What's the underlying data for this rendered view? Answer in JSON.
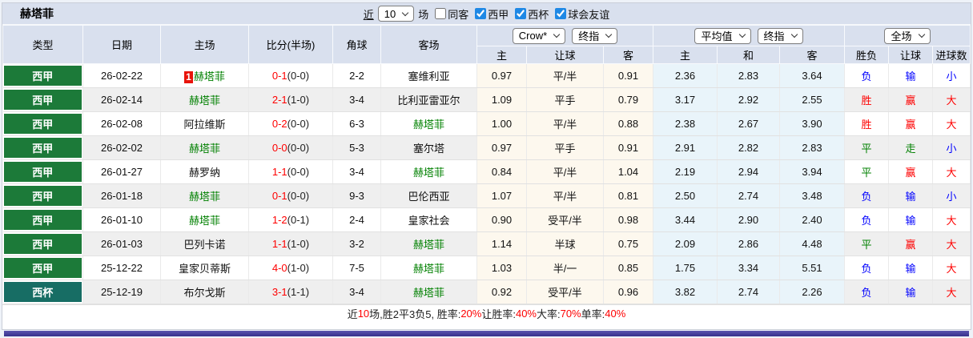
{
  "title": "赫塔菲",
  "toolbar": {
    "recent_label": "近",
    "recent_value": "10",
    "matches_label": "场",
    "checkboxes": [
      {
        "label": "同客",
        "checked": false
      },
      {
        "label": "西甲",
        "checked": true
      },
      {
        "label": "西杯",
        "checked": true
      },
      {
        "label": "球会友谊",
        "checked": true
      }
    ]
  },
  "table": {
    "columns": [
      "类型",
      "日期",
      "主场",
      "比分(半场)",
      "角球",
      "客场"
    ],
    "selects": {
      "bookmaker": "Crow*",
      "bookmaker_stage": "终指",
      "average": "平均值",
      "average_stage": "终指",
      "scope": "全场"
    },
    "sub_columns": [
      "主",
      "让球",
      "客",
      "主",
      "和",
      "客",
      "胜负",
      "让球",
      "进球数"
    ],
    "rows": [
      {
        "type": "西甲",
        "type_style": "league",
        "date": "26-02-22",
        "home": {
          "name": "赫塔菲",
          "green": true,
          "badge": "1"
        },
        "score": "0-1",
        "half": "(0-0)",
        "corners": "2-2",
        "away": {
          "name": "塞维利亚",
          "green": false
        },
        "odds": {
          "home": "0.97",
          "handicap": "平/半",
          "away": "0.91"
        },
        "avg": {
          "home": "2.36",
          "draw": "2.83",
          "away": "3.64"
        },
        "outcome": [
          {
            "text": "负",
            "c": "blue"
          },
          {
            "text": "输",
            "c": "blue"
          },
          {
            "text": "小",
            "c": "blue"
          }
        ]
      },
      {
        "type": "西甲",
        "type_style": "league",
        "date": "26-02-14",
        "home": {
          "name": "赫塔菲",
          "green": true
        },
        "score": "2-1",
        "half": "(1-0)",
        "corners": "3-4",
        "away": {
          "name": "比利亚雷亚尔",
          "green": false
        },
        "odds": {
          "home": "1.09",
          "handicap": "平手",
          "away": "0.79"
        },
        "avg": {
          "home": "3.17",
          "draw": "2.92",
          "away": "2.55"
        },
        "outcome": [
          {
            "text": "胜",
            "c": "red"
          },
          {
            "text": "赢",
            "c": "red"
          },
          {
            "text": "大",
            "c": "red"
          }
        ]
      },
      {
        "type": "西甲",
        "type_style": "league",
        "date": "26-02-08",
        "home": {
          "name": "阿拉维斯",
          "green": false
        },
        "score": "0-2",
        "half": "(0-0)",
        "corners": "6-3",
        "away": {
          "name": "赫塔菲",
          "green": true
        },
        "odds": {
          "home": "1.00",
          "handicap": "平/半",
          "away": "0.88"
        },
        "avg": {
          "home": "2.38",
          "draw": "2.67",
          "away": "3.90"
        },
        "outcome": [
          {
            "text": "胜",
            "c": "red"
          },
          {
            "text": "赢",
            "c": "red"
          },
          {
            "text": "大",
            "c": "red"
          }
        ]
      },
      {
        "type": "西甲",
        "type_style": "league",
        "date": "26-02-02",
        "home": {
          "name": "赫塔菲",
          "green": true
        },
        "score": "0-0",
        "half": "(0-0)",
        "corners": "5-3",
        "away": {
          "name": "塞尔塔",
          "green": false
        },
        "odds": {
          "home": "0.97",
          "handicap": "平手",
          "away": "0.91"
        },
        "avg": {
          "home": "2.91",
          "draw": "2.82",
          "away": "2.83"
        },
        "outcome": [
          {
            "text": "平",
            "c": "green"
          },
          {
            "text": "走",
            "c": "green"
          },
          {
            "text": "小",
            "c": "blue"
          }
        ]
      },
      {
        "type": "西甲",
        "type_style": "league",
        "date": "26-01-27",
        "home": {
          "name": "赫罗纳",
          "green": false
        },
        "score": "1-1",
        "half": "(0-0)",
        "corners": "3-4",
        "away": {
          "name": "赫塔菲",
          "green": true
        },
        "odds": {
          "home": "0.84",
          "handicap": "平/半",
          "away": "1.04"
        },
        "avg": {
          "home": "2.19",
          "draw": "2.94",
          "away": "3.94"
        },
        "outcome": [
          {
            "text": "平",
            "c": "green"
          },
          {
            "text": "赢",
            "c": "red"
          },
          {
            "text": "大",
            "c": "red"
          }
        ]
      },
      {
        "type": "西甲",
        "type_style": "league",
        "date": "26-01-18",
        "home": {
          "name": "赫塔菲",
          "green": true
        },
        "score": "0-1",
        "half": "(0-0)",
        "corners": "9-3",
        "away": {
          "name": "巴伦西亚",
          "green": false
        },
        "odds": {
          "home": "1.07",
          "handicap": "平/半",
          "away": "0.81"
        },
        "avg": {
          "home": "2.50",
          "draw": "2.74",
          "away": "3.48"
        },
        "outcome": [
          {
            "text": "负",
            "c": "blue"
          },
          {
            "text": "输",
            "c": "blue"
          },
          {
            "text": "小",
            "c": "blue"
          }
        ]
      },
      {
        "type": "西甲",
        "type_style": "league",
        "date": "26-01-10",
        "home": {
          "name": "赫塔菲",
          "green": true
        },
        "score": "1-2",
        "half": "(0-1)",
        "corners": "2-4",
        "away": {
          "name": "皇家社会",
          "green": false
        },
        "odds": {
          "home": "0.90",
          "handicap": "受平/半",
          "away": "0.98"
        },
        "avg": {
          "home": "3.44",
          "draw": "2.90",
          "away": "2.40"
        },
        "outcome": [
          {
            "text": "负",
            "c": "blue"
          },
          {
            "text": "输",
            "c": "blue"
          },
          {
            "text": "大",
            "c": "red"
          }
        ]
      },
      {
        "type": "西甲",
        "type_style": "league",
        "date": "26-01-03",
        "home": {
          "name": "巴列卡诺",
          "green": false
        },
        "score": "1-1",
        "half": "(1-0)",
        "corners": "3-2",
        "away": {
          "name": "赫塔菲",
          "green": true
        },
        "odds": {
          "home": "1.14",
          "handicap": "半球",
          "away": "0.75"
        },
        "avg": {
          "home": "2.09",
          "draw": "2.86",
          "away": "4.48"
        },
        "outcome": [
          {
            "text": "平",
            "c": "green"
          },
          {
            "text": "赢",
            "c": "red"
          },
          {
            "text": "大",
            "c": "red"
          }
        ]
      },
      {
        "type": "西甲",
        "type_style": "league",
        "date": "25-12-22",
        "home": {
          "name": "皇家贝蒂斯",
          "green": false
        },
        "score": "4-0",
        "half": "(1-0)",
        "corners": "7-5",
        "away": {
          "name": "赫塔菲",
          "green": true
        },
        "odds": {
          "home": "1.03",
          "handicap": "半/一",
          "away": "0.85"
        },
        "avg": {
          "home": "1.75",
          "draw": "3.34",
          "away": "5.51"
        },
        "outcome": [
          {
            "text": "负",
            "c": "blue"
          },
          {
            "text": "输",
            "c": "blue"
          },
          {
            "text": "大",
            "c": "red"
          }
        ]
      },
      {
        "type": "西杯",
        "type_style": "cup",
        "date": "25-12-19",
        "home": {
          "name": "布尔戈斯",
          "green": false
        },
        "score": "3-1",
        "half": "(1-1)",
        "corners": "3-4",
        "away": {
          "name": "赫塔菲",
          "green": true
        },
        "odds": {
          "home": "0.92",
          "handicap": "受平/半",
          "away": "0.96"
        },
        "avg": {
          "home": "3.82",
          "draw": "2.74",
          "away": "2.26"
        },
        "outcome": [
          {
            "text": "负",
            "c": "blue"
          },
          {
            "text": "输",
            "c": "blue"
          },
          {
            "text": "大",
            "c": "red"
          }
        ]
      }
    ]
  },
  "summary": {
    "segments": [
      {
        "text": "近",
        "red": false
      },
      {
        "text": "10",
        "red": true
      },
      {
        "text": "场,胜2平3负5, 胜率:",
        "red": false
      },
      {
        "text": "20%",
        "red": true
      },
      {
        "text": " 让胜率:",
        "red": false
      },
      {
        "text": "40%",
        "red": true
      },
      {
        "text": " 大率:",
        "red": false
      },
      {
        "text": "70%",
        "red": true
      },
      {
        "text": " 单率:",
        "red": false
      },
      {
        "text": "40%",
        "red": true
      }
    ]
  },
  "colors": {
    "league_green": "#1c7a39",
    "cup_teal": "#176d64",
    "win_red": "#fe0000",
    "lose_blue": "#0000fe",
    "draw_green": "#008000",
    "team_green": "#008000",
    "header_bg": "#d9e0ee",
    "odds_bg": "#fdf8ee",
    "avg_bg": "#e9f4fa",
    "bottom_bar": "#3d3795",
    "checkbox_blue": "#1e88e5"
  }
}
